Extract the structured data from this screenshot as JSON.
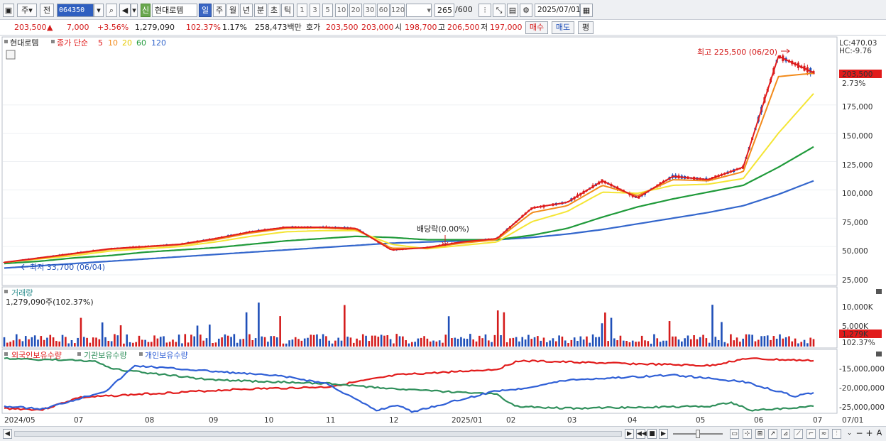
{
  "toolbar": {
    "mode": "주",
    "prev_label": "전",
    "code": "064350",
    "sin_label": "신",
    "stock_name": "현대로템",
    "tabs": [
      "일",
      "주",
      "월",
      "년",
      "분",
      "초",
      "틱"
    ],
    "active_tab": "일",
    "periods": [
      "1",
      "3",
      "5",
      "10",
      "20",
      "30",
      "60",
      "120"
    ],
    "count": "265",
    "count_total": "/600",
    "date": "2025/07/01"
  },
  "quote": {
    "price": "203,500",
    "arrow": "▲",
    "change": "7,000",
    "change_pct": "+3.56%",
    "volume": "1,279,090",
    "volume_ratio": "102.37%",
    "turnover": "1.17%",
    "amount": "258,473백만",
    "hoga_label": "호가",
    "ask": "203,500",
    "bid": "203,000",
    "open_label": "시",
    "open": "198,700",
    "high_label": "고",
    "high": "206,500",
    "low_label": "저",
    "low": "197,000",
    "buy_label": "매수",
    "sell_label": "매도",
    "avg_label": "평"
  },
  "price_panel": {
    "legend_name": "현대로템",
    "legend_ma_label": "종가 단순",
    "ma_periods": [
      "5",
      "10",
      "20",
      "60",
      "120"
    ],
    "lc": "LC:470.03",
    "hc": "HC:-9.76",
    "current_price": "203,500",
    "current_pct": "2.73%",
    "max_annotation": "최고 225,500 (06/20)",
    "min_annotation": "최저 33,700 (06/04)",
    "dividend_annotation": "배당락(0.00%)",
    "y_ticks": [
      "175,000",
      "150,000",
      "125,000",
      "100,000",
      "75,000",
      "50,000",
      "25,000"
    ]
  },
  "volume_panel": {
    "title": "거래량",
    "value": "1,279,090주(102.37%)",
    "y_ticks": [
      "10,000K",
      "5,000K"
    ],
    "current": "1,279K",
    "current_pct": "102.37%"
  },
  "holding_panel": {
    "legends": [
      "외국인보유수량",
      "기관보유수량",
      "개인보유수량"
    ],
    "y_ticks": [
      "-15,000,000",
      "-20,000,000",
      "-25,000,000"
    ]
  },
  "x_axis": {
    "labels": [
      "2024/05",
      "07",
      "08",
      "09",
      "10",
      "11",
      "12",
      "2025/01",
      "02",
      "03",
      "04",
      "05",
      "06",
      "07",
      "07/01"
    ]
  },
  "colors": {
    "up": "#d41c1c",
    "down": "#1f4fb8",
    "ma5": "#e11b1b",
    "ma10": "#f28a1a",
    "ma20": "#f4e534",
    "ma60": "#1f9a3a",
    "ma120": "#3366cc",
    "foreign": "#e11b1b",
    "institution": "#2f8f5b",
    "individual": "#2f5fd6"
  },
  "chart_data": {
    "type": "line",
    "title": "현대로템",
    "series": [
      {
        "name": "5",
        "values": [
          36000,
          40000,
          44000,
          48000,
          50000,
          52000,
          57000,
          63000,
          67000,
          67000,
          66000,
          47000,
          49000,
          54000,
          57000,
          84000,
          89000,
          108000,
          93000,
          112000,
          109000,
          120000,
          218000,
          203500
        ]
      },
      {
        "name": "10",
        "values": [
          36000,
          39500,
          43500,
          47500,
          49500,
          51500,
          56000,
          62000,
          66000,
          66500,
          65000,
          48500,
          48500,
          53000,
          56000,
          80000,
          86000,
          104000,
          95000,
          109000,
          108000,
          116000,
          200000,
          203000
        ]
      },
      {
        "name": "20",
        "values": [
          36000,
          39000,
          42000,
          46000,
          48000,
          50000,
          54000,
          59000,
          63000,
          64000,
          64000,
          52000,
          48000,
          51000,
          54000,
          72000,
          81000,
          98000,
          97000,
          104000,
          105000,
          110000,
          150000,
          185000
        ]
      },
      {
        "name": "60",
        "values": [
          35000,
          37000,
          40000,
          42000,
          45000,
          47000,
          49000,
          52000,
          55000,
          57000,
          59000,
          58000,
          56000,
          56000,
          56000,
          60000,
          66000,
          76000,
          85000,
          92000,
          98000,
          104000,
          120000,
          138000
        ]
      },
      {
        "name": "120",
        "values": [
          31000,
          33000,
          35000,
          37000,
          39000,
          41000,
          43000,
          45000,
          47000,
          49000,
          51000,
          53000,
          54000,
          55000,
          56000,
          58000,
          61000,
          65000,
          70000,
          75000,
          80000,
          86000,
          96000,
          108000
        ]
      }
    ],
    "ylabel": "",
    "ylim": [
      20000,
      235000
    ]
  }
}
